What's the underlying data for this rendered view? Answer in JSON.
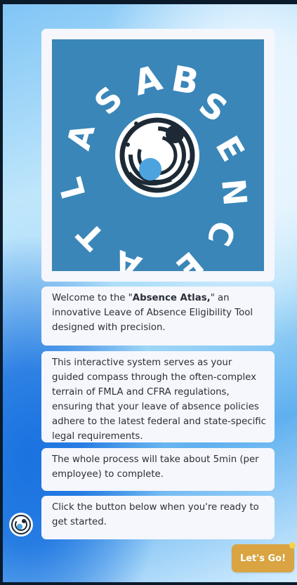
{
  "logo": {
    "lettering": "ABSENCE ATLAS"
  },
  "messages": [
    {
      "pre": "Welcome to the \"",
      "bold": "Absence Atlas,",
      "post": "\" an innovative Leave of Absence Eligibility Tool designed with precision."
    },
    {
      "text": "This interactive system serves as your guided compass through the often-complex terrain of FMLA and CFRA regulations, ensuring that your leave of absence policies adhere to the latest federal and state-specific legal requirements."
    },
    {
      "text": "The whole process will take about 5min (per employee) to complete."
    },
    {
      "text": "Click the button below when you're ready to get started."
    }
  ],
  "button": {
    "label": "Let's Go!"
  },
  "colors": {
    "logo_bg": "#3a86b8",
    "button_bg": "#d9a441",
    "card_bg": "#f5f7fc"
  }
}
